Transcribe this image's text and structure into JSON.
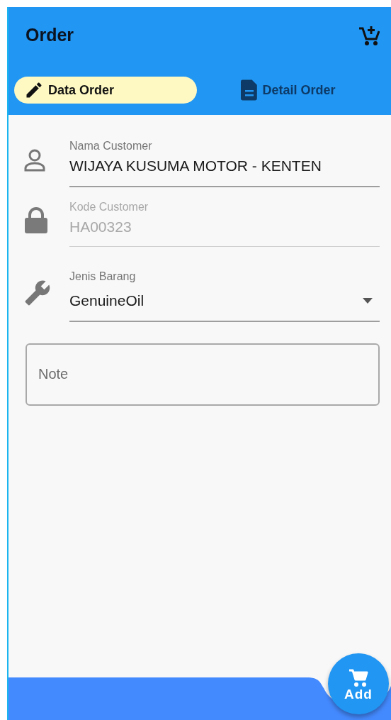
{
  "app_bar": {
    "title": "Order"
  },
  "tabs": [
    {
      "label": "Data Order",
      "selected": true
    },
    {
      "label": "Detail Order",
      "selected": false
    }
  ],
  "fields": [
    {
      "kind": "text",
      "label": "Nama Customer",
      "value": "WIJAYA KUSUMA MOTOR - KENTEN",
      "disabled": false
    },
    {
      "kind": "text",
      "label": "Kode Customer",
      "value": "HA00323",
      "disabled": true
    },
    {
      "kind": "dropdown",
      "label": "Jenis Barang",
      "value": "GenuineOil",
      "disabled": false
    }
  ],
  "note": {
    "placeholder": "Note"
  },
  "fab": {
    "label": "Add"
  }
}
